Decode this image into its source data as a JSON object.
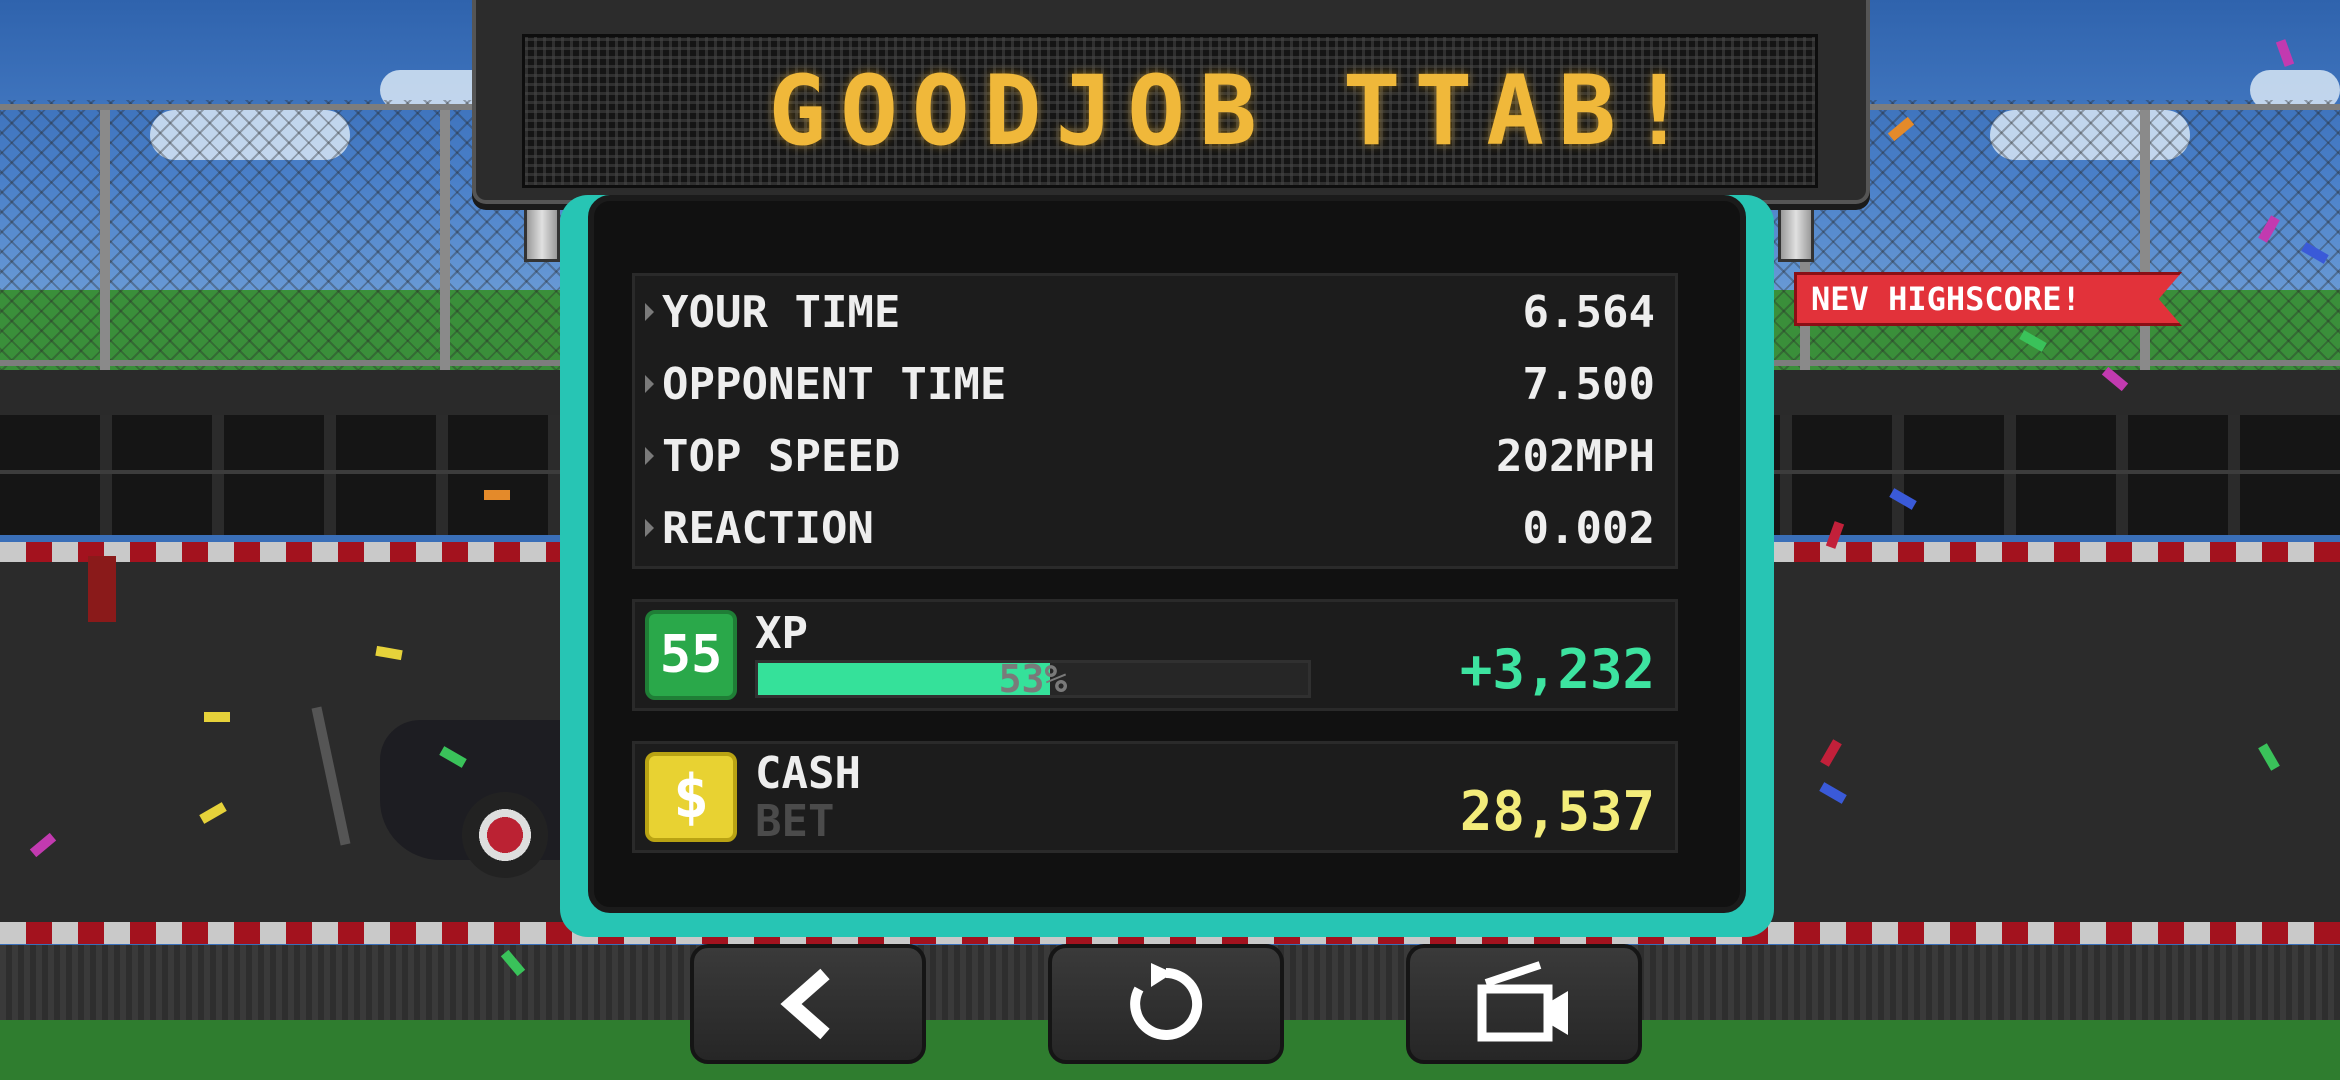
{
  "banner": {
    "text": "GOODJOB TTAB!"
  },
  "highscore_ribbon": {
    "text": "NEV HIGHSCORE!"
  },
  "results": {
    "stats": [
      {
        "label": "YOUR TIME",
        "value": "6.564"
      },
      {
        "label": "OPPONENT TIME",
        "value": "7.500"
      },
      {
        "label": "TOP SPEED",
        "value": "202MPH"
      },
      {
        "label": "REACTION",
        "value": "0.002"
      }
    ],
    "xp": {
      "level": "55",
      "label": "XP",
      "progress_percent": 53,
      "progress_text": "53%",
      "gain": "+3,232"
    },
    "cash": {
      "icon_glyph": "$",
      "label": "CASH",
      "bet_label": "BET",
      "value": "28,537"
    }
  },
  "buttons": {
    "back": {
      "icon": "back-chevron-icon"
    },
    "restart": {
      "icon": "restart-icon"
    },
    "replay": {
      "icon": "video-camera-icon"
    }
  },
  "colors": {
    "panel_frame": "#27c5b4",
    "led_text": "#f0b83a",
    "xp_fill": "#35e19a",
    "xp_gain": "#3de3a0",
    "cash_value": "#f3ec7a",
    "highscore_bg": "#e2323a",
    "level_badge": "#2aa84a",
    "cash_badge": "#e8d232"
  }
}
